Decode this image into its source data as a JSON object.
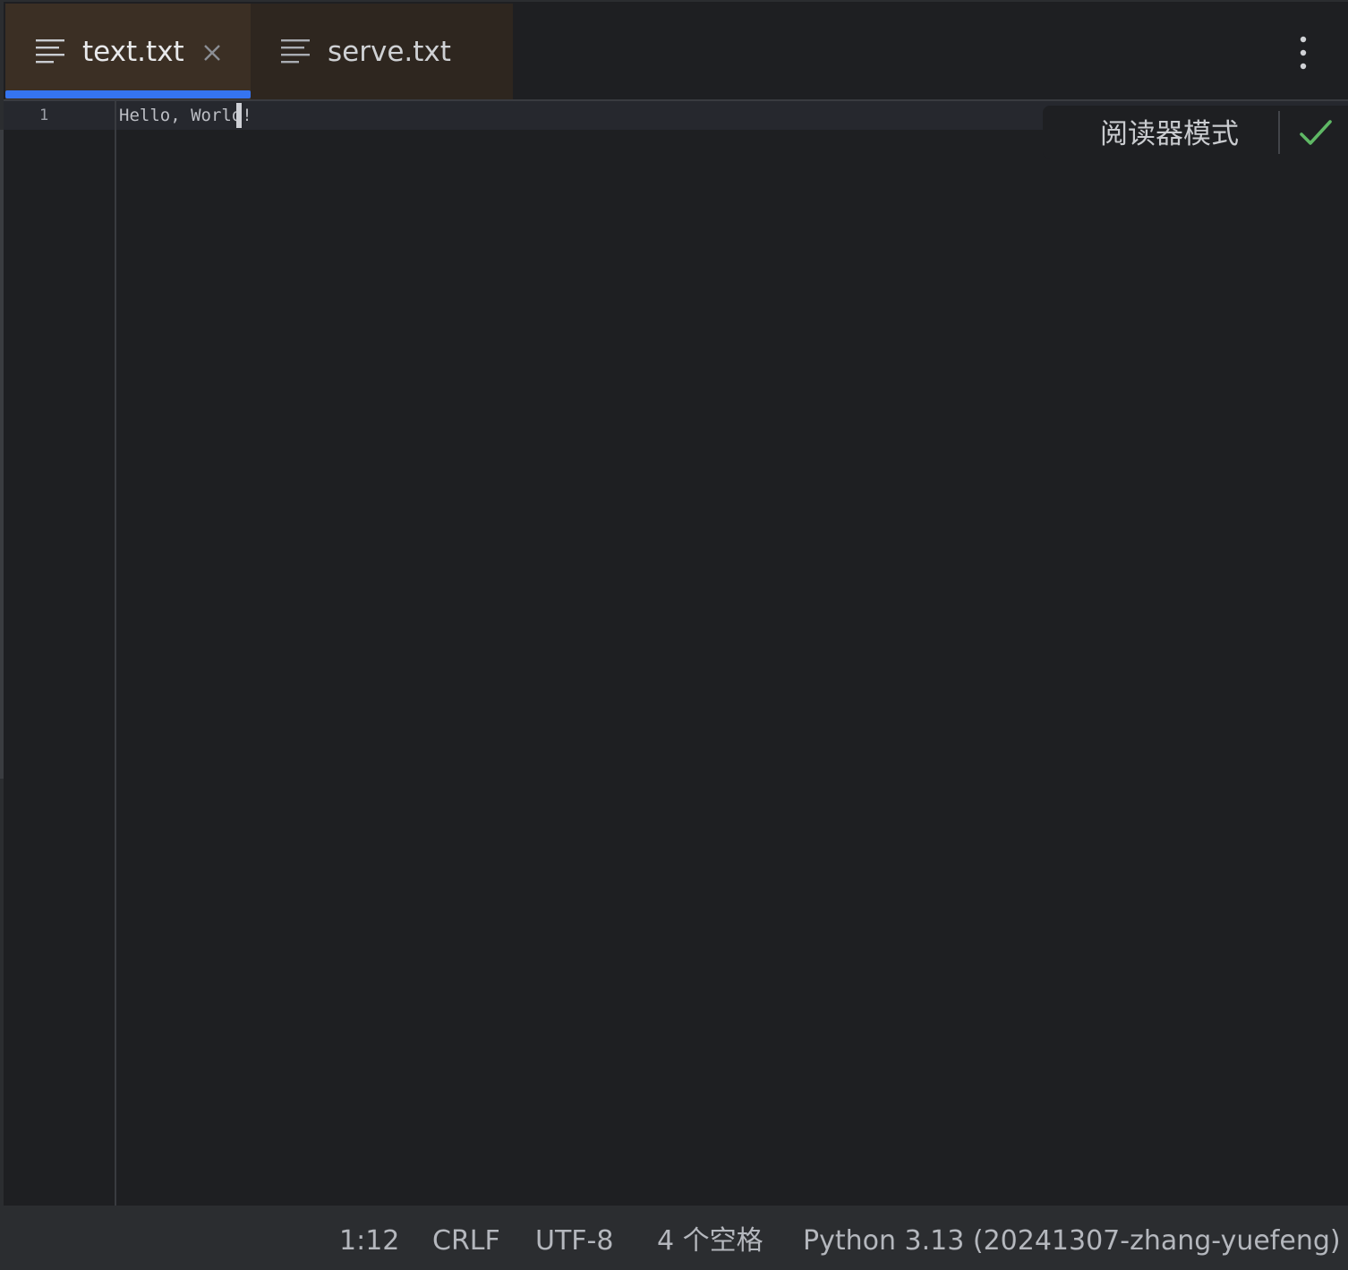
{
  "tabs": [
    {
      "label": "text.txt",
      "active": true
    },
    {
      "label": "serve.txt",
      "active": false
    }
  ],
  "editor": {
    "lines": [
      {
        "number": "1",
        "text": "Hello, World!"
      }
    ]
  },
  "reader_mode": {
    "label": "阅读器模式"
  },
  "status": {
    "position": "1:12",
    "line_ending": "CRLF",
    "encoding": "UTF-8",
    "indent": "4 个空格",
    "interpreter": "Python 3.13 (20241307-zhang-yuefeng)"
  },
  "colors": {
    "accent": "#3574f0",
    "check": "#5fb865",
    "active_tab_bg": "#3b2f24"
  },
  "icons": {
    "file_type": "text-lines-icon",
    "close": "close-icon",
    "more": "more-vertical-icon",
    "check": "check-icon"
  }
}
